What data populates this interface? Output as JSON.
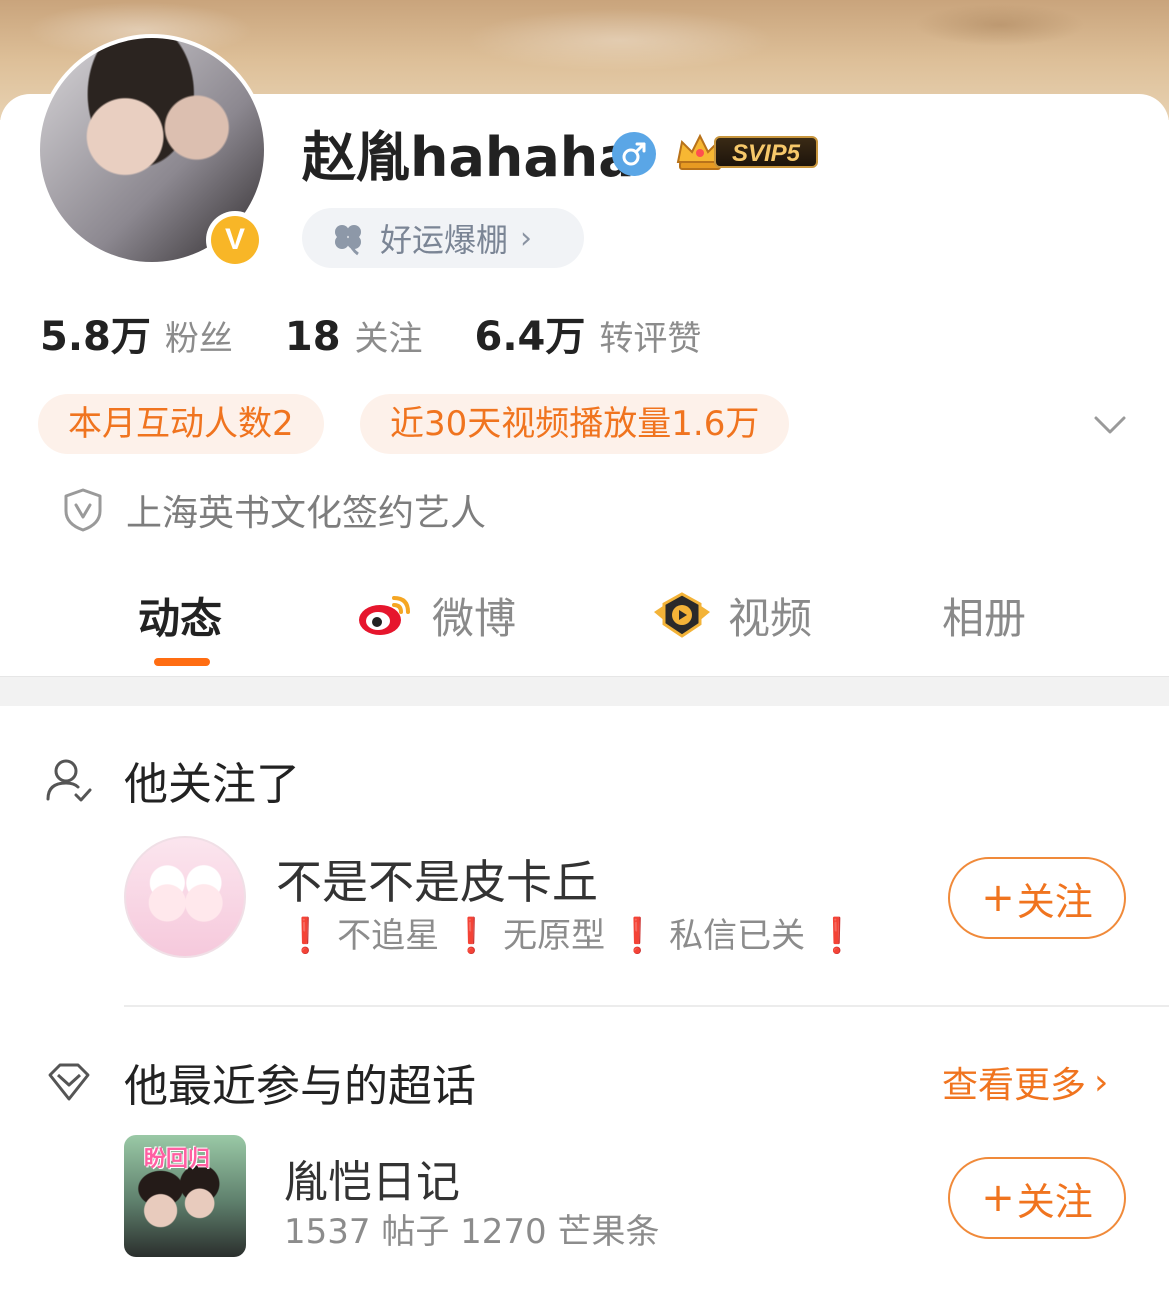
{
  "profile": {
    "username": "赵胤hahaha",
    "verified_mark": "V",
    "vip_label": "SVIP5",
    "luck_label": "好运爆棚",
    "luck_chevron": "›"
  },
  "stats": [
    {
      "value": "5.8万",
      "label": "粉丝"
    },
    {
      "value": "18",
      "label": "关注"
    },
    {
      "value": "6.4万",
      "label": "转评赞"
    }
  ],
  "tags": [
    "本月互动人数2",
    "近30天视频播放量1.6万"
  ],
  "certification": "上海英书文化签约艺人",
  "tabs": [
    {
      "label": "动态",
      "active": true
    },
    {
      "label": "微博",
      "active": false
    },
    {
      "label": "视频",
      "active": false
    },
    {
      "label": "相册",
      "active": false
    }
  ],
  "followed_section": {
    "title": "他关注了",
    "user": {
      "name": "不是不是皮卡丘",
      "bio_parts": [
        "❗",
        "不追星",
        "❗",
        "无原型",
        "❗",
        "私信已关",
        "❗"
      ]
    },
    "follow_label": "关注",
    "follow_plus": "+"
  },
  "topics_section": {
    "title": "他最近参与的超话",
    "see_more": "查看更多",
    "see_more_chevron": "›",
    "topic": {
      "thumb_text": "盼回归",
      "name": "胤恺日记",
      "meta": "1537 帖子 1270 芒果条"
    },
    "follow_label": "关注",
    "follow_plus": "+"
  },
  "colors": {
    "accent": "#f0741f",
    "tab_indicator": "#ff6d12",
    "tag_bg": "#fdf1ea",
    "gender_blue": "#5aa6e6",
    "verified_gold": "#f8b627"
  },
  "icons": [
    "male-gender-icon",
    "crown-icon",
    "clover-icon",
    "chevron-down-icon",
    "shield-v-icon",
    "weibo-logo-icon",
    "video-logo-icon",
    "user-check-icon",
    "diamond-icon",
    "chevron-right-icon"
  ]
}
